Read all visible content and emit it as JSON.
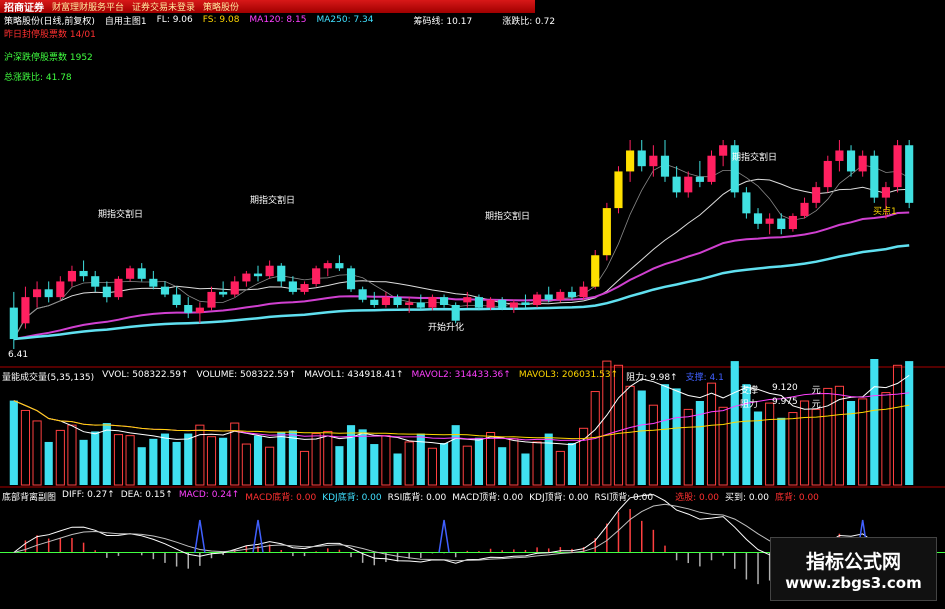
{
  "header": {
    "brand": "招商证券",
    "menu": [
      "财富理财服务平台",
      "证券交易未登录",
      "策略股份"
    ],
    "stock_name": "策略股份(日线,前复权)",
    "overlay_label": "自用主图1",
    "readouts": [
      {
        "label": "FL: 9.06",
        "color": "#ffffff"
      },
      {
        "label": "FS: 9.08",
        "color": "#ffd700"
      },
      {
        "label": "MA120: 8.15",
        "color": "#ff40ff"
      },
      {
        "label": "MA250: 7.34",
        "color": "#40e0ff"
      },
      {
        "label": "筹码线: 10.17",
        "color": "#ffffff"
      },
      {
        "label": "涨跌比: 0.72",
        "color": "#ffffff"
      }
    ]
  },
  "side_stats": [
    {
      "text": "昨日封停股票数 14/01",
      "color": "#ff3030"
    },
    {
      "text": "沪深跌停股票数 1952",
      "color": "#40ff40"
    },
    {
      "text": "总涨跌比: 41.78",
      "color": "#40ff40"
    }
  ],
  "annotations": {
    "breakout_label": "期指交割日",
    "open_label": "开始升化",
    "buy_label": "买点1",
    "low_price": "6.41"
  },
  "volume_panel": {
    "title": "量能成交量(5,35,135)",
    "readouts": [
      {
        "label": "VVOL: 508322.59↑",
        "color": "#ffffff"
      },
      {
        "label": "VOLUME: 508322.59↑",
        "color": "#ffffff"
      },
      {
        "label": "MAVOL1: 434918.41↑",
        "color": "#ffffff"
      },
      {
        "label": "MAVOL2: 314433.36↑",
        "color": "#ff40ff"
      },
      {
        "label": "MAVOL3: 206031.53↑",
        "color": "#ffd700"
      },
      {
        "label": "阻力: 9.98↑",
        "color": "#ffffff"
      },
      {
        "label": "支撑: 4.1",
        "color": "#4060ff"
      }
    ],
    "support_label": "支撑",
    "support_value": "9.120",
    "support_unit": "元",
    "resist_label": "阻力",
    "resist_value": "9.975",
    "resist_unit": "元"
  },
  "macd_panel": {
    "title": "底部背离副图",
    "readouts": [
      {
        "label": "DIFF: 0.27↑",
        "color": "#ffffff"
      },
      {
        "label": "DEA: 0.15↑",
        "color": "#ffffff"
      },
      {
        "label": "MACD: 0.24↑",
        "color": "#ff40ff"
      },
      {
        "label": "MACD底背: 0.00",
        "color": "#ff3030"
      },
      {
        "label": "KDJ底背: 0.00",
        "color": "#40e0ff"
      },
      {
        "label": "RSI底背: 0.00",
        "color": "#ffffff"
      },
      {
        "label": "MACD顶背: 0.00",
        "color": "#ffffff"
      },
      {
        "label": "KDJ顶背: 0.00",
        "color": "#ffffff"
      },
      {
        "label": "RSI顶背: 0.00",
        "color": "#ffffff"
      },
      {
        "label": "选股: 0.00",
        "color": "#ff3030"
      },
      {
        "label": "买到: 0.00",
        "color": "#ffffff"
      },
      {
        "label": "底背: 0.00",
        "color": "#ff3030"
      }
    ]
  },
  "watermark": {
    "cn": "指标公式网",
    "url": "www.zbgs3.com"
  },
  "chart_data": {
    "type": "candlestick",
    "price_ylim": [
      6.2,
      10.4
    ],
    "candles": [
      {
        "o": 7.2,
        "h": 7.5,
        "l": 6.41,
        "c": 6.6
      },
      {
        "o": 6.9,
        "h": 7.6,
        "l": 6.8,
        "c": 7.4
      },
      {
        "o": 7.4,
        "h": 7.7,
        "l": 7.2,
        "c": 7.55
      },
      {
        "o": 7.55,
        "h": 7.7,
        "l": 7.3,
        "c": 7.4
      },
      {
        "o": 7.4,
        "h": 7.8,
        "l": 7.35,
        "c": 7.7
      },
      {
        "o": 7.7,
        "h": 8.0,
        "l": 7.6,
        "c": 7.9
      },
      {
        "o": 7.9,
        "h": 8.1,
        "l": 7.7,
        "c": 7.8
      },
      {
        "o": 7.8,
        "h": 7.9,
        "l": 7.5,
        "c": 7.6
      },
      {
        "o": 7.6,
        "h": 7.7,
        "l": 7.3,
        "c": 7.4
      },
      {
        "o": 7.4,
        "h": 7.8,
        "l": 7.35,
        "c": 7.75
      },
      {
        "o": 7.75,
        "h": 8.0,
        "l": 7.7,
        "c": 7.95
      },
      {
        "o": 7.95,
        "h": 8.05,
        "l": 7.7,
        "c": 7.75
      },
      {
        "o": 7.75,
        "h": 7.9,
        "l": 7.55,
        "c": 7.6
      },
      {
        "o": 7.6,
        "h": 7.7,
        "l": 7.4,
        "c": 7.45
      },
      {
        "o": 7.45,
        "h": 7.6,
        "l": 7.2,
        "c": 7.25
      },
      {
        "o": 7.25,
        "h": 7.4,
        "l": 7.0,
        "c": 7.1
      },
      {
        "o": 7.1,
        "h": 7.3,
        "l": 6.9,
        "c": 7.2
      },
      {
        "o": 7.2,
        "h": 7.6,
        "l": 7.15,
        "c": 7.5
      },
      {
        "o": 7.5,
        "h": 7.7,
        "l": 7.4,
        "c": 7.45
      },
      {
        "o": 7.45,
        "h": 7.8,
        "l": 7.4,
        "c": 7.7
      },
      {
        "o": 7.7,
        "h": 7.9,
        "l": 7.6,
        "c": 7.85
      },
      {
        "o": 7.85,
        "h": 8.0,
        "l": 7.7,
        "c": 7.8
      },
      {
        "o": 7.8,
        "h": 8.1,
        "l": 7.75,
        "c": 8.0
      },
      {
        "o": 8.0,
        "h": 8.05,
        "l": 7.6,
        "c": 7.7
      },
      {
        "o": 7.7,
        "h": 7.8,
        "l": 7.45,
        "c": 7.5
      },
      {
        "o": 7.5,
        "h": 7.7,
        "l": 7.45,
        "c": 7.65
      },
      {
        "o": 7.65,
        "h": 8.0,
        "l": 7.6,
        "c": 7.95
      },
      {
        "o": 7.95,
        "h": 8.1,
        "l": 7.8,
        "c": 8.05
      },
      {
        "o": 8.05,
        "h": 8.2,
        "l": 7.9,
        "c": 7.95
      },
      {
        "o": 7.95,
        "h": 8.0,
        "l": 7.5,
        "c": 7.55
      },
      {
        "o": 7.55,
        "h": 7.6,
        "l": 7.3,
        "c": 7.35
      },
      {
        "o": 7.35,
        "h": 7.5,
        "l": 7.2,
        "c": 7.25
      },
      {
        "o": 7.25,
        "h": 7.5,
        "l": 7.2,
        "c": 7.4
      },
      {
        "o": 7.4,
        "h": 7.45,
        "l": 7.2,
        "c": 7.25
      },
      {
        "o": 7.25,
        "h": 7.4,
        "l": 7.1,
        "c": 7.3
      },
      {
        "o": 7.3,
        "h": 7.45,
        "l": 7.15,
        "c": 7.2
      },
      {
        "o": 7.2,
        "h": 7.45,
        "l": 7.15,
        "c": 7.4
      },
      {
        "o": 7.4,
        "h": 7.45,
        "l": 7.2,
        "c": 7.25
      },
      {
        "o": 7.25,
        "h": 7.3,
        "l": 6.9,
        "c": 6.95
      },
      {
        "o": 7.3,
        "h": 7.5,
        "l": 7.2,
        "c": 7.4
      },
      {
        "o": 7.4,
        "h": 7.45,
        "l": 7.15,
        "c": 7.2
      },
      {
        "o": 7.2,
        "h": 7.4,
        "l": 7.15,
        "c": 7.35
      },
      {
        "o": 7.35,
        "h": 7.4,
        "l": 7.15,
        "c": 7.2
      },
      {
        "o": 7.2,
        "h": 7.35,
        "l": 7.1,
        "c": 7.3
      },
      {
        "o": 7.3,
        "h": 7.45,
        "l": 7.2,
        "c": 7.25
      },
      {
        "o": 7.25,
        "h": 7.5,
        "l": 7.2,
        "c": 7.45
      },
      {
        "o": 7.45,
        "h": 7.6,
        "l": 7.3,
        "c": 7.35
      },
      {
        "o": 7.35,
        "h": 7.55,
        "l": 7.3,
        "c": 7.5
      },
      {
        "o": 7.5,
        "h": 7.6,
        "l": 7.35,
        "c": 7.4
      },
      {
        "o": 7.4,
        "h": 7.7,
        "l": 7.35,
        "c": 7.6
      },
      {
        "o": 7.6,
        "h": 8.3,
        "l": 7.55,
        "c": 8.2
      },
      {
        "o": 8.2,
        "h": 9.2,
        "l": 8.1,
        "c": 9.1
      },
      {
        "o": 9.1,
        "h": 9.9,
        "l": 9.0,
        "c": 9.8
      },
      {
        "o": 9.8,
        "h": 10.4,
        "l": 9.6,
        "c": 10.2
      },
      {
        "o": 10.2,
        "h": 10.4,
        "l": 9.8,
        "c": 9.9
      },
      {
        "o": 9.9,
        "h": 10.3,
        "l": 9.7,
        "c": 10.1
      },
      {
        "o": 10.1,
        "h": 10.4,
        "l": 9.6,
        "c": 9.7
      },
      {
        "o": 9.7,
        "h": 9.9,
        "l": 9.3,
        "c": 9.4
      },
      {
        "o": 9.4,
        "h": 9.8,
        "l": 9.3,
        "c": 9.7
      },
      {
        "o": 9.7,
        "h": 10.0,
        "l": 9.5,
        "c": 9.6
      },
      {
        "o": 9.6,
        "h": 10.2,
        "l": 9.55,
        "c": 10.1
      },
      {
        "o": 10.1,
        "h": 10.4,
        "l": 9.9,
        "c": 10.3
      },
      {
        "o": 10.3,
        "h": 10.4,
        "l": 9.3,
        "c": 9.4
      },
      {
        "o": 9.4,
        "h": 9.5,
        "l": 8.9,
        "c": 9.0
      },
      {
        "o": 9.0,
        "h": 9.1,
        "l": 8.7,
        "c": 8.8
      },
      {
        "o": 8.8,
        "h": 9.0,
        "l": 8.6,
        "c": 8.9
      },
      {
        "o": 8.9,
        "h": 9.0,
        "l": 8.6,
        "c": 8.7
      },
      {
        "o": 8.7,
        "h": 9.0,
        "l": 8.65,
        "c": 8.95
      },
      {
        "o": 8.95,
        "h": 9.3,
        "l": 8.9,
        "c": 9.2
      },
      {
        "o": 9.2,
        "h": 9.6,
        "l": 9.1,
        "c": 9.5
      },
      {
        "o": 9.5,
        "h": 10.1,
        "l": 9.4,
        "c": 10.0
      },
      {
        "o": 10.0,
        "h": 10.4,
        "l": 9.8,
        "c": 10.2
      },
      {
        "o": 10.2,
        "h": 10.3,
        "l": 9.7,
        "c": 9.8
      },
      {
        "o": 9.8,
        "h": 10.2,
        "l": 9.7,
        "c": 10.1
      },
      {
        "o": 10.1,
        "h": 10.2,
        "l": 9.2,
        "c": 9.3
      },
      {
        "o": 9.3,
        "h": 9.6,
        "l": 8.9,
        "c": 9.5
      },
      {
        "o": 9.5,
        "h": 10.4,
        "l": 9.4,
        "c": 10.3
      },
      {
        "o": 10.3,
        "h": 10.4,
        "l": 9.1,
        "c": 9.2
      }
    ],
    "volume_ylim": [
      0,
      1000000
    ],
    "macd_ylim": [
      -0.6,
      0.6
    ]
  }
}
